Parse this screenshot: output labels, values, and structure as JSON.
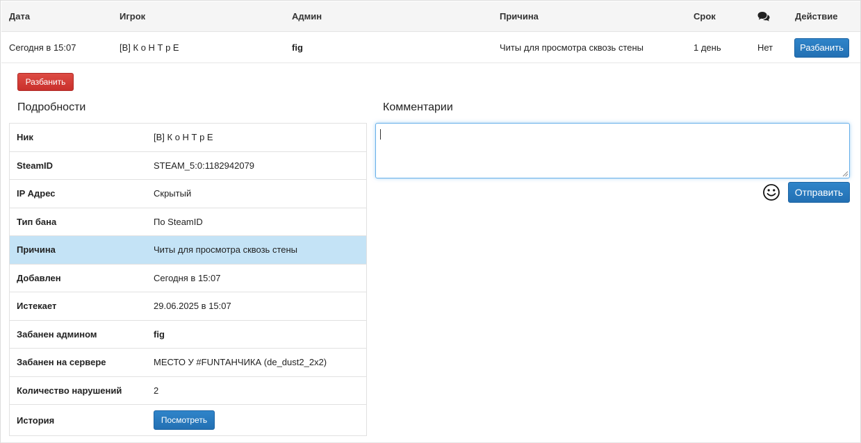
{
  "table": {
    "headers": {
      "date": "Дата",
      "player": "Игрок",
      "admin": "Админ",
      "reason": "Причина",
      "term": "Срок",
      "comments_icon": "comments-icon",
      "action": "Действие"
    },
    "row": {
      "date": "Сегодня в 15:07",
      "player": "[В] К о Н Т р Е",
      "admin": "fig",
      "reason": "Читы для просмотра сквозь стены",
      "term": "1 день",
      "comments": "Нет",
      "action_label": "Разбанить"
    }
  },
  "unban_button": "Разбанить",
  "details": {
    "title": "Подробности",
    "rows": [
      {
        "key": "Ник",
        "value": "[В] К о Н Т р Е"
      },
      {
        "key": "SteamID",
        "value": "STEAM_5:0:1182942079"
      },
      {
        "key": "IP Адрес",
        "value": "Скрытый"
      },
      {
        "key": "Тип бана",
        "value": "По SteamID"
      },
      {
        "key": "Причина",
        "value": "Читы для просмотра сквозь стены"
      },
      {
        "key": "Добавлен",
        "value": "Сегодня в 15:07"
      },
      {
        "key": "Истекает",
        "value": "29.06.2025 в 15:07"
      },
      {
        "key": "Забанен админом",
        "value": "fig"
      },
      {
        "key": "Забанен на сервере",
        "value": "МЕСТО У #FUNТАНЧИКА (de_dust2_2x2)"
      },
      {
        "key": "Количество нарушений",
        "value": "2"
      },
      {
        "key": "История",
        "button": "Посмотреть"
      }
    ]
  },
  "comments": {
    "title": "Комментарии",
    "input_value": "",
    "smiley_icon": "smiley-icon",
    "send_label": "Отправить"
  },
  "colors": {
    "primary": "#2370b3",
    "danger": "#c9302c",
    "highlight_row": "#c4e3f6",
    "focus_border": "#66afe9"
  }
}
